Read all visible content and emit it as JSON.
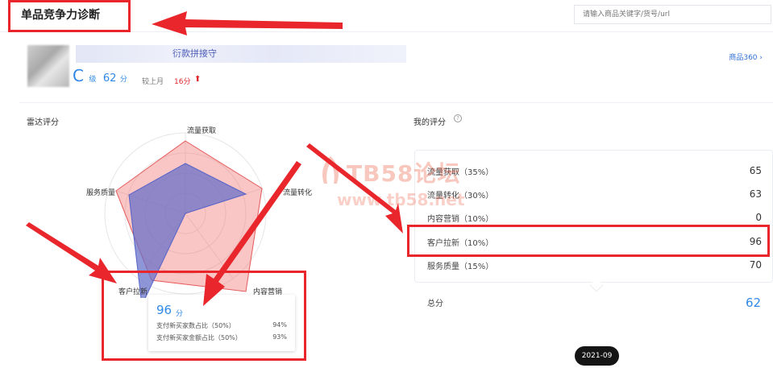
{
  "header": {
    "title": "单品竞争力诊断",
    "search_placeholder": "请输入商品关键字/货号/url"
  },
  "product": {
    "name_visible": "衍款拼接守",
    "grade_letter": "C",
    "grade_suffix": "级",
    "score": "62",
    "score_unit": "分",
    "compare_label": "较上月",
    "compare_value": "16分",
    "link": "商品360 ›"
  },
  "radar": {
    "title": "雷达评分",
    "axes": [
      "流量获取",
      "流量转化",
      "内容营销",
      "客户拉新",
      "服务质量"
    ],
    "tooltip": {
      "score": "96",
      "unit": "分",
      "rows": [
        {
          "label": "支付新买家数占比（50%）",
          "value": "94%"
        },
        {
          "label": "支付新买家金额占比（50%）",
          "value": "93%"
        }
      ]
    }
  },
  "my_score": {
    "title": "我的评分",
    "rows": [
      {
        "label": "流量获取（35%）",
        "value": "65"
      },
      {
        "label": "流量转化（30%）",
        "value": "63"
      },
      {
        "label": "内容营销（10%）",
        "value": "0"
      },
      {
        "label": "客户拉新（10%）",
        "value": "96"
      },
      {
        "label": "服务质量（15%）",
        "value": "70"
      }
    ],
    "total_label": "总分",
    "total_value": "62"
  },
  "date": "2021-09",
  "watermark": {
    "line1": "TB58论坛",
    "line2": "www.tb58.net"
  },
  "colors": {
    "accent": "#2f88e8",
    "annotation": "#e8262b",
    "up": "#e0232b"
  }
}
